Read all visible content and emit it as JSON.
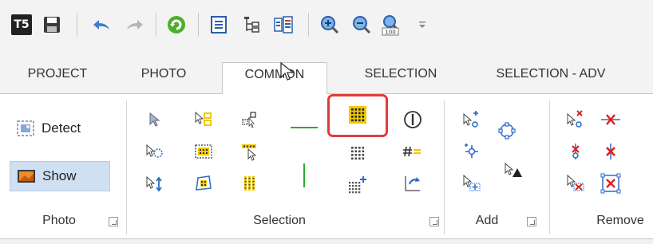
{
  "quick_access": {
    "app_logo_text": "T5",
    "buttons": [
      "save-icon",
      "undo-icon",
      "redo-icon",
      "refresh-icon",
      "list-view-icon",
      "tree-view-icon",
      "details-icon",
      "zoom-in-icon",
      "zoom-out-icon",
      "zoom-100-icon",
      "customize-icon"
    ],
    "zoom_100_text": "100"
  },
  "tabs": [
    {
      "label": "PROJECT"
    },
    {
      "label": "PHOTO"
    },
    {
      "label": "COMMON",
      "active": true
    },
    {
      "label": "SELECTION"
    },
    {
      "label": "SELECTION - ADV"
    }
  ],
  "groups": {
    "photo": {
      "label": "Photo",
      "detect_label": "Detect",
      "show_label": "Show"
    },
    "selection": {
      "label": "Selection"
    },
    "add": {
      "label": "Add"
    },
    "remove": {
      "label": "Remove"
    }
  },
  "colors": {
    "accent_yellow": "#f2c800",
    "accent_blue": "#2a6bc7",
    "accent_red": "#e02020",
    "accent_green": "#22b02a",
    "focus_ring": "#e23b3b",
    "show_highlight": "#cfe0f2"
  }
}
